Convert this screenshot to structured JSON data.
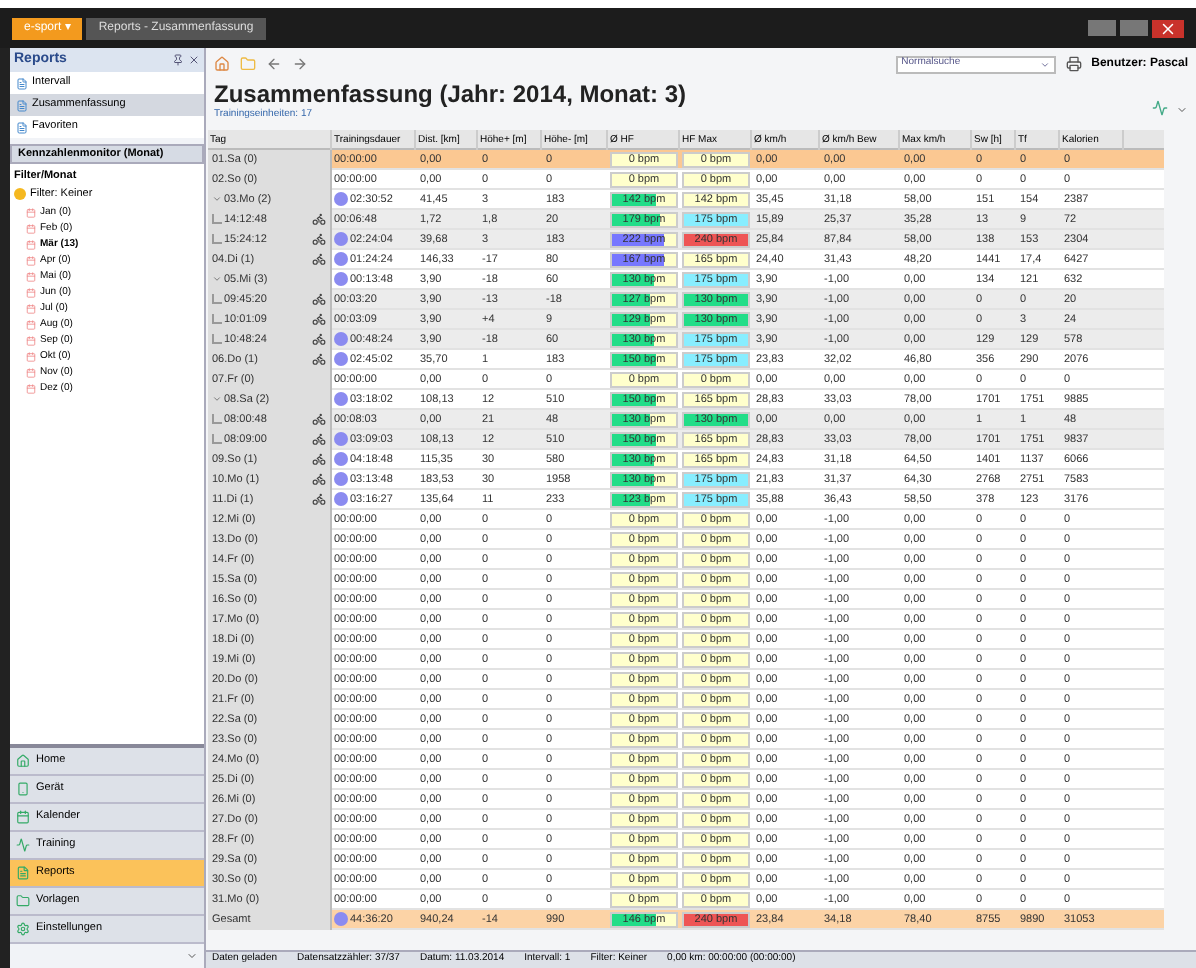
{
  "titlebar": {
    "app_button": "e-sport ▾",
    "tab": "Reports - Zusammenfassung"
  },
  "sidebar": {
    "title": "Reports",
    "items": [
      {
        "label": "Intervall",
        "selected": false
      },
      {
        "label": "Zusammenfassung",
        "selected": true
      },
      {
        "label": "Favoriten",
        "selected": false
      }
    ],
    "section": "Kennzahlenmonitor (Monat)",
    "filter_title": "Filter/Monat",
    "filter_label": "Filter: Keiner",
    "months": [
      {
        "label": "Jan (0)",
        "selected": false
      },
      {
        "label": "Feb (0)",
        "selected": false
      },
      {
        "label": "Mär (13)",
        "selected": true
      },
      {
        "label": "Apr (0)",
        "selected": false
      },
      {
        "label": "Mai (0)",
        "selected": false
      },
      {
        "label": "Jun (0)",
        "selected": false
      },
      {
        "label": "Jul (0)",
        "selected": false
      },
      {
        "label": "Aug (0)",
        "selected": false
      },
      {
        "label": "Sep (0)",
        "selected": false
      },
      {
        "label": "Okt (0)",
        "selected": false
      },
      {
        "label": "Nov (0)",
        "selected": false
      },
      {
        "label": "Dez (0)",
        "selected": false
      }
    ],
    "nav": [
      {
        "label": "Home",
        "selected": false
      },
      {
        "label": "Gerät",
        "selected": false
      },
      {
        "label": "Kalender",
        "selected": false
      },
      {
        "label": "Training",
        "selected": false
      },
      {
        "label": "Reports",
        "selected": true
      },
      {
        "label": "Vorlagen",
        "selected": false
      },
      {
        "label": "Einstellungen",
        "selected": false
      }
    ]
  },
  "toolbar": {
    "search": "Normalsuche",
    "user": "Benutzer: Pascal"
  },
  "title": "Zusammenfassung (Jahr: 2014, Monat: 3)",
  "subtitle": "Trainingseinheiten: 17",
  "table": {
    "columns": [
      "Tag",
      "Trainingsdauer",
      "Dist. [km]",
      "Höhe+ [m]",
      "Höhe- [m]",
      "Ø HF",
      "HF Max",
      "Ø km/h",
      "Ø km/h Bew",
      "Max km/h",
      "Sw [h]",
      "Tf",
      "Kalorien"
    ],
    "rows": [
      {
        "selected": true,
        "cells": [
          "01.Sa (0)",
          "00:00:00",
          "0,00",
          "0",
          "0",
          "0 bpm",
          "0 bpm",
          "0,00",
          "0,00",
          "0,00",
          "0",
          "0",
          "0"
        ],
        "hf_max": {
          "color": "#ffffcc"
        }
      },
      {
        "selected": false,
        "cells": [
          "02.So (0)",
          "00:00:00",
          "0,00",
          "0",
          "0",
          "0 bpm",
          "0 bpm",
          "0,00",
          "0,00",
          "0,00",
          "0",
          "0",
          "0"
        ],
        "hf_max": {
          "color": "#ffffcc"
        }
      },
      {
        "selected": false,
        "expanded": true,
        "marker": true,
        "cells": [
          "03.Mo (2)",
          "02:30:52",
          "41,45",
          "3",
          "183",
          "142 bpm",
          "142 bpm",
          "35,45",
          "31,18",
          "58,00",
          "151",
          "154",
          "2387"
        ],
        "hf_avg": {
          "level": 0.7,
          "color": "#22dd88"
        },
        "hf_max": {
          "color": "#ffffcc"
        },
        "children": [
          {
            "selected": false,
            "activity": true,
            "cells": [
              "14:12:48",
              "00:06:48",
              "1,72",
              "1,8",
              "20",
              "179 bpm",
              "175 bpm",
              "15,89",
              "25,37",
              "35,28",
              "13",
              "9",
              "72"
            ],
            "hf_avg": {
              "level": 0.75,
              "color": "#22dd88"
            },
            "hf_max": {
              "color": "#88eeff"
            }
          },
          {
            "selected": false,
            "marker": true,
            "activity": true,
            "cells": [
              "15:24:12",
              "02:24:04",
              "39,68",
              "3",
              "183",
              "222 bpm",
              "240 bpm",
              "25,84",
              "87,84",
              "58,00",
              "138",
              "153",
              "2304"
            ],
            "hf_avg": {
              "level": 0.8,
              "color": "#7777ff"
            },
            "hf_max": {
              "color": "#ee5555"
            }
          }
        ]
      },
      {
        "selected": false,
        "marker": true,
        "activity": true,
        "cells": [
          "04.Di (1)",
          "01:24:24",
          "146,33",
          "-17",
          "80",
          "167 bpm",
          "165 bpm",
          "24,40",
          "31,43",
          "48,20",
          "1441",
          "17,4",
          "6427"
        ],
        "hf_avg": {
          "level": 0.8,
          "color": "#7777ff"
        },
        "hf_max": {
          "color": "#ffffcc"
        }
      },
      {
        "selected": false,
        "expanded": true,
        "marker": true,
        "cells": [
          "05.Mi (3)",
          "00:13:48",
          "3,90",
          "-18",
          "60",
          "130 bpm",
          "175 bpm",
          "3,90",
          "-1,00",
          "0,00",
          "134",
          "121",
          "632"
        ],
        "hf_avg": {
          "level": 0.65,
          "color": "#22dd88"
        },
        "hf_max": {
          "color": "#88eeff"
        },
        "children": [
          {
            "selected": false,
            "activity": true,
            "cells": [
              "09:45:20",
              "00:03:20",
              "3,90",
              "-13",
              "-18",
              "127 bpm",
              "130 bpm",
              "3,90",
              "-1,00",
              "0,00",
              "0",
              "0",
              "20"
            ],
            "hf_avg": {
              "level": 0.6,
              "color": "#22dd88"
            },
            "hf_max": {
              "color": "#22dd88"
            }
          },
          {
            "selected": false,
            "activity": true,
            "cells": [
              "10:01:09",
              "00:03:09",
              "3,90",
              "+4",
              "9",
              "129 bpm",
              "130 bpm",
              "3,90",
              "-1,00",
              "0,00",
              "0",
              "3",
              "24"
            ],
            "hf_avg": {
              "level": 0.6,
              "color": "#22dd88"
            },
            "hf_max": {
              "color": "#22dd88"
            }
          },
          {
            "selected": false,
            "marker": true,
            "activity": true,
            "cells": [
              "10:48:24",
              "00:48:24",
              "3,90",
              "-18",
              "60",
              "130 bpm",
              "175 bpm",
              "3,90",
              "-1,00",
              "0,00",
              "129",
              "129",
              "578"
            ],
            "hf_avg": {
              "level": 0.65,
              "color": "#22dd88"
            },
            "hf_max": {
              "color": "#88eeff"
            }
          }
        ]
      },
      {
        "selected": false,
        "marker": true,
        "activity": true,
        "cells": [
          "06.Do (1)",
          "02:45:02",
          "35,70",
          "1",
          "183",
          "150 bpm",
          "175 bpm",
          "23,83",
          "32,02",
          "46,80",
          "356",
          "290",
          "2076"
        ],
        "hf_avg": {
          "level": 0.7,
          "color": "#22dd88"
        },
        "hf_max": {
          "color": "#88eeff"
        }
      },
      {
        "selected": false,
        "cells": [
          "07.Fr (0)",
          "00:00:00",
          "0,00",
          "0",
          "0",
          "0 bpm",
          "0 bpm",
          "0,00",
          "0,00",
          "0,00",
          "0",
          "0",
          "0"
        ],
        "hf_max": {
          "color": "#ffffcc"
        }
      },
      {
        "selected": false,
        "expanded": true,
        "marker": true,
        "cells": [
          "08.Sa (2)",
          "03:18:02",
          "108,13",
          "12",
          "510",
          "150 bpm",
          "165 bpm",
          "28,83",
          "33,03",
          "78,00",
          "1701",
          "1751",
          "9885"
        ],
        "hf_avg": {
          "level": 0.7,
          "color": "#22dd88"
        },
        "hf_max": {
          "color": "#ffffcc"
        },
        "children": [
          {
            "selected": false,
            "activity": true,
            "cells": [
              "08:00:48",
              "00:08:03",
              "0,00",
              "21",
              "48",
              "130 bpm",
              "130 bpm",
              "0,00",
              "0,00",
              "0,00",
              "1",
              "1",
              "48"
            ],
            "hf_avg": {
              "level": 0.6,
              "color": "#22dd88"
            },
            "hf_max": {
              "color": "#22dd88"
            }
          },
          {
            "selected": false,
            "marker": true,
            "activity": true,
            "cells": [
              "08:09:00",
              "03:09:03",
              "108,13",
              "12",
              "510",
              "150 bpm",
              "165 bpm",
              "28,83",
              "33,03",
              "78,00",
              "1701",
              "1751",
              "9837"
            ],
            "hf_avg": {
              "level": 0.7,
              "color": "#22dd88"
            },
            "hf_max": {
              "color": "#ffffcc"
            }
          }
        ]
      },
      {
        "selected": false,
        "marker": true,
        "activity": true,
        "cells": [
          "09.So (1)",
          "04:18:48",
          "115,35",
          "30",
          "580",
          "130 bpm",
          "165 bpm",
          "24,83",
          "31,18",
          "64,50",
          "1401",
          "1137",
          "6066"
        ],
        "hf_avg": {
          "level": 0.65,
          "color": "#22dd88"
        },
        "hf_max": {
          "color": "#ffffcc"
        }
      },
      {
        "selected": false,
        "marker": true,
        "activity": true,
        "cells": [
          "10.Mo (1)",
          "03:13:48",
          "183,53",
          "30",
          "1958",
          "130 bpm",
          "175 bpm",
          "21,83",
          "31,37",
          "64,30",
          "2768",
          "2751",
          "7583"
        ],
        "hf_avg": {
          "level": 0.65,
          "color": "#22dd88"
        },
        "hf_max": {
          "color": "#88eeff"
        }
      },
      {
        "selected": false,
        "marker": true,
        "activity": true,
        "cells": [
          "11.Di (1)",
          "03:16:27",
          "135,64",
          "11",
          "233",
          "123 bpm",
          "175 bpm",
          "35,88",
          "36,43",
          "58,50",
          "378",
          "123",
          "3176"
        ],
        "hf_avg": {
          "level": 0.6,
          "color": "#22dd88"
        },
        "hf_max": {
          "color": "#88eeff"
        }
      },
      {
        "selected": false,
        "cells": [
          "12.Mi (0)",
          "00:00:00",
          "0,00",
          "0",
          "0",
          "0 bpm",
          "0 bpm",
          "0,00",
          "-1,00",
          "0,00",
          "0",
          "0",
          "0"
        ],
        "hf_max": {
          "color": "#ffffcc"
        }
      },
      {
        "selected": false,
        "cells": [
          "13.Do (0)",
          "00:00:00",
          "0,00",
          "0",
          "0",
          "0 bpm",
          "0 bpm",
          "0,00",
          "-1,00",
          "0,00",
          "0",
          "0",
          "0"
        ],
        "hf_max": {
          "color": "#ffffcc"
        }
      },
      {
        "selected": false,
        "cells": [
          "14.Fr (0)",
          "00:00:00",
          "0,00",
          "0",
          "0",
          "0 bpm",
          "0 bpm",
          "0,00",
          "-1,00",
          "0,00",
          "0",
          "0",
          "0"
        ],
        "hf_max": {
          "color": "#ffffcc"
        }
      },
      {
        "selected": false,
        "cells": [
          "15.Sa (0)",
          "00:00:00",
          "0,00",
          "0",
          "0",
          "0 bpm",
          "0 bpm",
          "0,00",
          "-1,00",
          "0,00",
          "0",
          "0",
          "0"
        ],
        "hf_max": {
          "color": "#ffffcc"
        }
      },
      {
        "selected": false,
        "cells": [
          "16.So (0)",
          "00:00:00",
          "0,00",
          "0",
          "0",
          "0 bpm",
          "0 bpm",
          "0,00",
          "-1,00",
          "0,00",
          "0",
          "0",
          "0"
        ],
        "hf_max": {
          "color": "#ffffcc"
        }
      },
      {
        "selected": false,
        "cells": [
          "17.Mo (0)",
          "00:00:00",
          "0,00",
          "0",
          "0",
          "0 bpm",
          "0 bpm",
          "0,00",
          "-1,00",
          "0,00",
          "0",
          "0",
          "0"
        ],
        "hf_max": {
          "color": "#ffffcc"
        }
      },
      {
        "selected": false,
        "cells": [
          "18.Di (0)",
          "00:00:00",
          "0,00",
          "0",
          "0",
          "0 bpm",
          "0 bpm",
          "0,00",
          "-1,00",
          "0,00",
          "0",
          "0",
          "0"
        ],
        "hf_max": {
          "color": "#ffffcc"
        }
      },
      {
        "selected": false,
        "cells": [
          "19.Mi (0)",
          "00:00:00",
          "0,00",
          "0",
          "0",
          "0 bpm",
          "0 bpm",
          "0,00",
          "-1,00",
          "0,00",
          "0",
          "0",
          "0"
        ],
        "hf_max": {
          "color": "#ffffcc"
        }
      },
      {
        "selected": false,
        "cells": [
          "20.Do (0)",
          "00:00:00",
          "0,00",
          "0",
          "0",
          "0 bpm",
          "0 bpm",
          "0,00",
          "-1,00",
          "0,00",
          "0",
          "0",
          "0"
        ],
        "hf_max": {
          "color": "#ffffcc"
        }
      },
      {
        "selected": false,
        "cells": [
          "21.Fr (0)",
          "00:00:00",
          "0,00",
          "0",
          "0",
          "0 bpm",
          "0 bpm",
          "0,00",
          "-1,00",
          "0,00",
          "0",
          "0",
          "0"
        ],
        "hf_max": {
          "color": "#ffffcc"
        }
      },
      {
        "selected": false,
        "cells": [
          "22.Sa (0)",
          "00:00:00",
          "0,00",
          "0",
          "0",
          "0 bpm",
          "0 bpm",
          "0,00",
          "-1,00",
          "0,00",
          "0",
          "0",
          "0"
        ],
        "hf_max": {
          "color": "#ffffcc"
        }
      },
      {
        "selected": false,
        "cells": [
          "23.So (0)",
          "00:00:00",
          "0,00",
          "0",
          "0",
          "0 bpm",
          "0 bpm",
          "0,00",
          "-1,00",
          "0,00",
          "0",
          "0",
          "0"
        ],
        "hf_max": {
          "color": "#ffffcc"
        }
      },
      {
        "selected": false,
        "cells": [
          "24.Mo (0)",
          "00:00:00",
          "0,00",
          "0",
          "0",
          "0 bpm",
          "0 bpm",
          "0,00",
          "-1,00",
          "0,00",
          "0",
          "0",
          "0"
        ],
        "hf_max": {
          "color": "#ffffcc"
        }
      },
      {
        "selected": false,
        "cells": [
          "25.Di (0)",
          "00:00:00",
          "0,00",
          "0",
          "0",
          "0 bpm",
          "0 bpm",
          "0,00",
          "-1,00",
          "0,00",
          "0",
          "0",
          "0"
        ],
        "hf_max": {
          "color": "#ffffcc"
        }
      },
      {
        "selected": false,
        "cells": [
          "26.Mi (0)",
          "00:00:00",
          "0,00",
          "0",
          "0",
          "0 bpm",
          "0 bpm",
          "0,00",
          "-1,00",
          "0,00",
          "0",
          "0",
          "0"
        ],
        "hf_max": {
          "color": "#ffffcc"
        }
      },
      {
        "selected": false,
        "cells": [
          "27.Do (0)",
          "00:00:00",
          "0,00",
          "0",
          "0",
          "0 bpm",
          "0 bpm",
          "0,00",
          "-1,00",
          "0,00",
          "0",
          "0",
          "0"
        ],
        "hf_max": {
          "color": "#ffffcc"
        }
      },
      {
        "selected": false,
        "cells": [
          "28.Fr (0)",
          "00:00:00",
          "0,00",
          "0",
          "0",
          "0 bpm",
          "0 bpm",
          "0,00",
          "-1,00",
          "0,00",
          "0",
          "0",
          "0"
        ],
        "hf_max": {
          "color": "#ffffcc"
        }
      },
      {
        "selected": false,
        "cells": [
          "29.Sa (0)",
          "00:00:00",
          "0,00",
          "0",
          "0",
          "0 bpm",
          "0 bpm",
          "0,00",
          "-1,00",
          "0,00",
          "0",
          "0",
          "0"
        ],
        "hf_max": {
          "color": "#ffffcc"
        }
      },
      {
        "selected": false,
        "cells": [
          "30.So (0)",
          "00:00:00",
          "0,00",
          "0",
          "0",
          "0 bpm",
          "0 bpm",
          "0,00",
          "-1,00",
          "0,00",
          "0",
          "0",
          "0"
        ],
        "hf_max": {
          "color": "#ffffcc"
        }
      },
      {
        "selected": false,
        "cells": [
          "31.Mo (0)",
          "00:00:00",
          "0,00",
          "0",
          "0",
          "0 bpm",
          "0 bpm",
          "0,00",
          "-1,00",
          "0,00",
          "0",
          "0",
          "0"
        ],
        "hf_max": {
          "color": "#ffffcc"
        }
      }
    ],
    "total": {
      "marker": true,
      "cells": [
        "Gesamt",
        "44:36:20",
        "940,24",
        "-14",
        "990",
        "146 bpm",
        "240 bpm",
        "23,84",
        "34,18",
        "78,40",
        "8755",
        "9890",
        "31053"
      ],
      "hf_avg": {
        "level": 0.7,
        "color": "#22dd88"
      },
      "hf_max": {
        "color": "#ee5555"
      }
    }
  },
  "status_bar": [
    "Daten geladen",
    "Datensatzzähler: 37/37",
    "Datum: 11.03.2014",
    "Intervall: 1",
    "Filter: Keiner",
    "0,00 km: 00:00:00 (00:00:00)"
  ]
}
